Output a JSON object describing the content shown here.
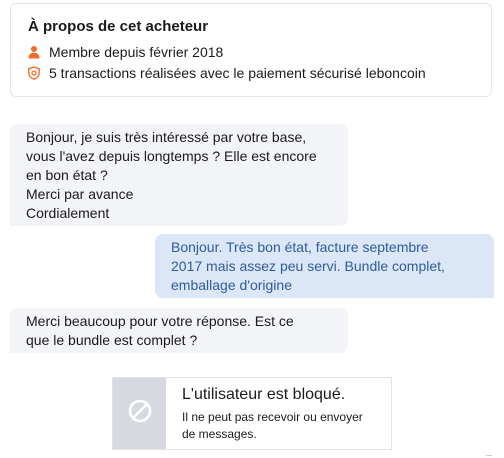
{
  "about": {
    "title": "À propos de cet acheteur",
    "member_since": "Membre depuis février 2018",
    "transactions": "5 transactions réalisées avec le paiement sécurisé leboncoin",
    "icons": {
      "member": "person-icon",
      "transactions": "shield-icon"
    },
    "accent": "#f56b2a"
  },
  "messages": [
    {
      "direction": "incoming",
      "lines": [
        "Bonjour, je suis très intéressé par votre base,",
        "vous l'avez depuis longtemps ? Elle est encore",
        "en bon état ?",
        "Merci par avance",
        "Cordialement"
      ]
    },
    {
      "direction": "outgoing",
      "lines": [
        "Bonjour. Très bon état, facture septembre",
        "2017 mais assez peu servi. Bundle complet,",
        "emballage d'origine"
      ]
    },
    {
      "direction": "incoming",
      "lines": [
        "Merci beaucoup pour votre réponse. Est ce",
        "que le bundle est complet ?"
      ]
    }
  ],
  "blocked": {
    "icon": "blocked-icon",
    "title": "L'utilisateur est bloqué.",
    "description_lines": [
      "Il ne peut pas recevoir ou envoyer",
      "de messages."
    ]
  },
  "colors": {
    "incoming_bg": "#f3f4f7",
    "outgoing_bg": "#dbe6f6",
    "outgoing_text": "#2f5d9a",
    "blocked_side": "#d6d9e0"
  }
}
